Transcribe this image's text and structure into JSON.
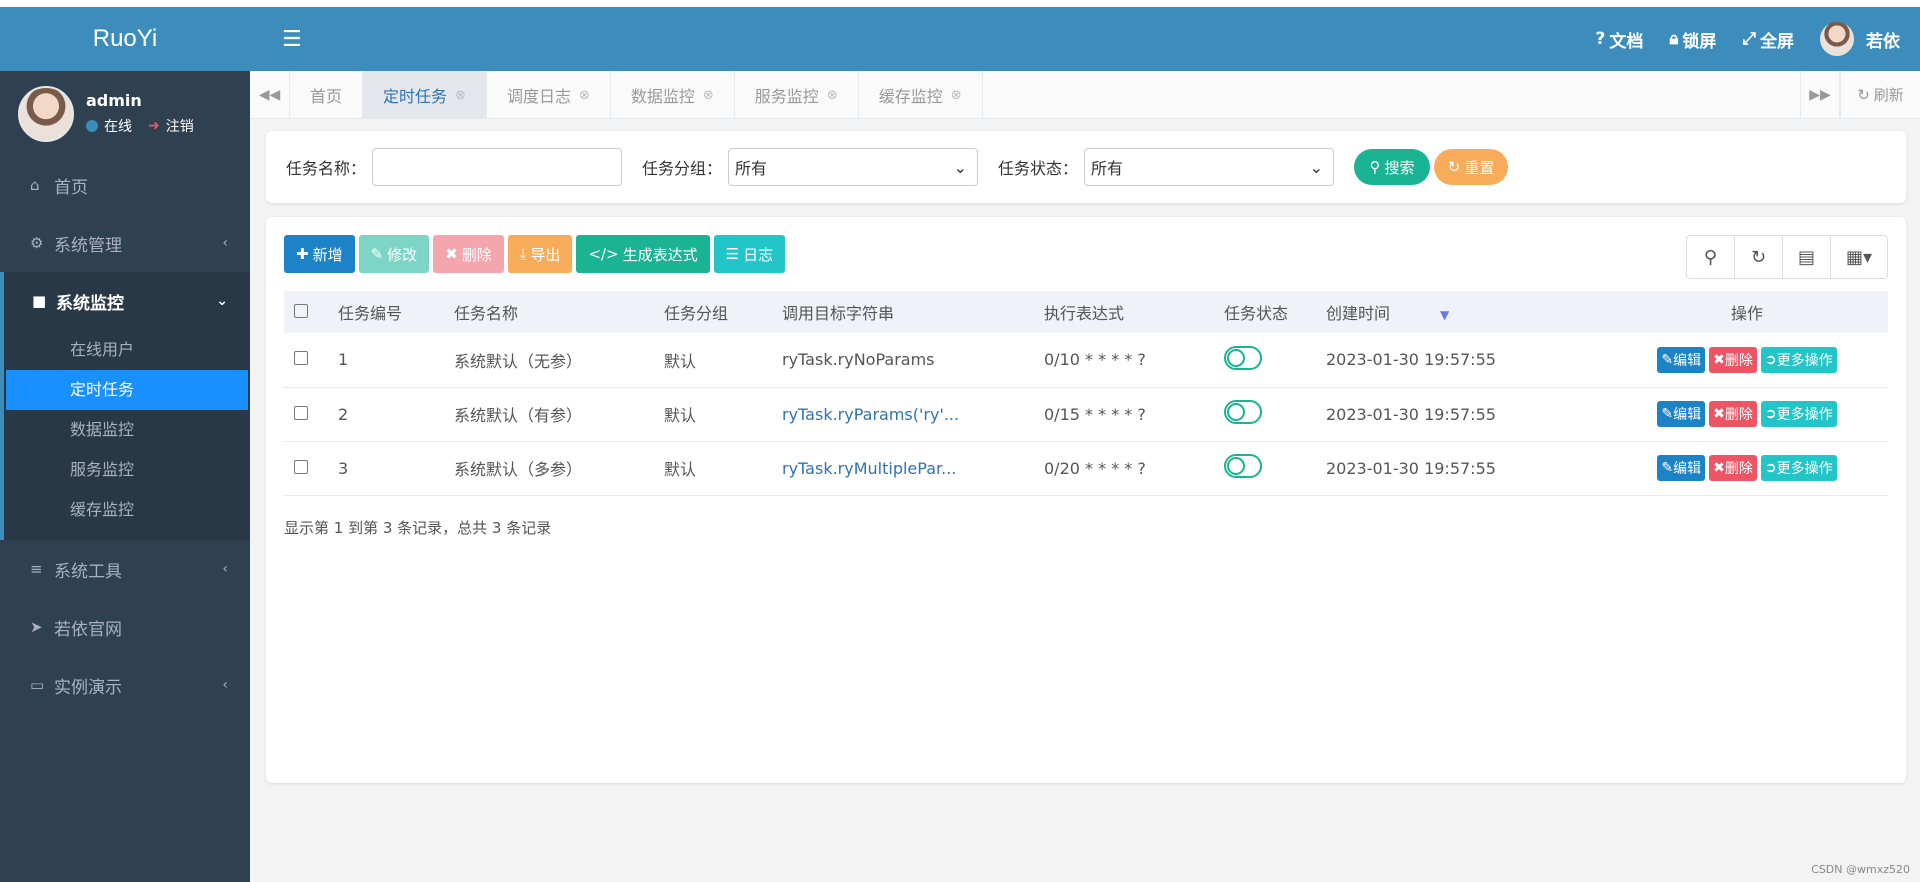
{
  "app": {
    "logo": "RuoYi"
  },
  "user": {
    "name": "admin",
    "status": "在线",
    "logout": "注销",
    "header_name": "若依"
  },
  "sidebar": {
    "items": [
      {
        "label": "首页"
      },
      {
        "label": "系统管理"
      },
      {
        "label": "系统监控"
      },
      {
        "label": "系统工具"
      },
      {
        "label": "若依官网"
      },
      {
        "label": "实例演示"
      }
    ],
    "monitor_sub": [
      "在线用户",
      "定时任务",
      "数据监控",
      "服务监控",
      "缓存监控"
    ]
  },
  "header": {
    "docs": "文档",
    "lock": "锁屏",
    "fullscreen": "全屏"
  },
  "tabs": [
    "首页",
    "定时任务",
    "调度日志",
    "数据监控",
    "服务监控",
    "缓存监控"
  ],
  "tab_refresh": "刷新",
  "search": {
    "name_label": "任务名称：",
    "group_label": "任务分组：",
    "group_value": "所有",
    "status_label": "任务状态：",
    "status_value": "所有",
    "search_btn": "搜索",
    "reset_btn": "重置"
  },
  "toolbar": {
    "add": "新增",
    "edit": "修改",
    "delete": "删除",
    "export": "导出",
    "cron": "生成表达式",
    "log": "日志"
  },
  "table": {
    "headers": [
      "任务编号",
      "任务名称",
      "任务分组",
      "调用目标字符串",
      "执行表达式",
      "任务状态",
      "创建时间",
      "操作"
    ],
    "rows": [
      {
        "id": "1",
        "name": "系统默认（无参）",
        "group": "默认",
        "target": "ryTask.ryNoParams",
        "cron": "0/10 * * * * ?",
        "status": "on",
        "created": "2023-01-30 19:57:55"
      },
      {
        "id": "2",
        "name": "系统默认（有参）",
        "group": "默认",
        "target": "ryTask.ryParams('ry'...",
        "cron": "0/15 * * * * ?",
        "status": "on",
        "created": "2023-01-30 19:57:55"
      },
      {
        "id": "3",
        "name": "系统默认（多参）",
        "group": "默认",
        "target": "ryTask.ryMultiplePar...",
        "cron": "0/20 * * * * ?",
        "status": "on",
        "created": "2023-01-30 19:57:55"
      }
    ],
    "op_edit": "编辑",
    "op_delete": "删除",
    "op_more": "更多操作"
  },
  "pagination_text": "显示第 1 到第 3 条记录，总共 3 条记录",
  "watermark": "CSDN @wmxz520",
  "colors": {
    "header": "#3c8dbc",
    "sidebar": "#2f4050",
    "primary": "#1c84c6",
    "success": "#1ab394",
    "danger": "#ed5565",
    "warning": "#f8ac59",
    "info": "#23c6c8",
    "active_sub": "#1890ff"
  }
}
